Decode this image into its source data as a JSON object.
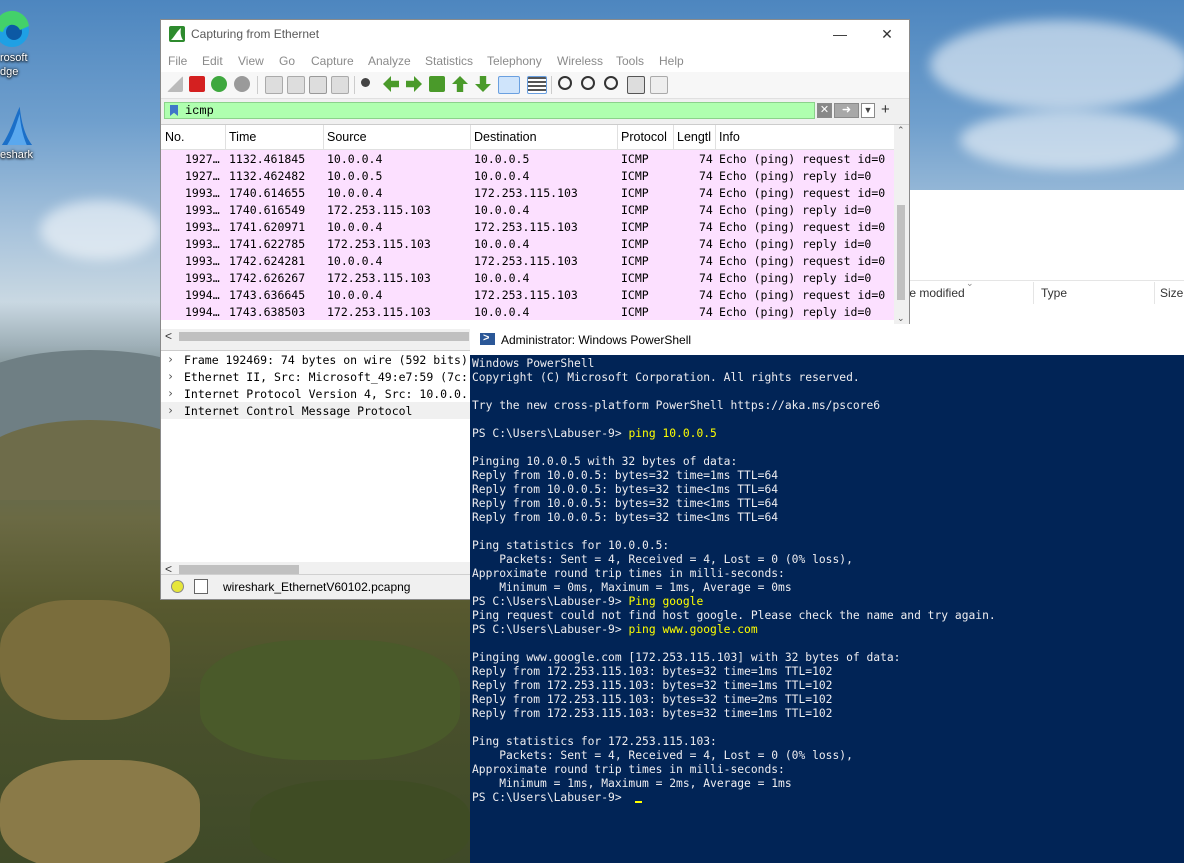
{
  "desktop": {
    "icons": [
      {
        "label_line1": "rosoft",
        "label_line2": "dge"
      },
      {
        "label_line1": "eshark",
        "label_line2": ""
      }
    ]
  },
  "explorer": {
    "columns": [
      "te modified",
      "Type",
      "Size"
    ]
  },
  "wireshark": {
    "title": "Capturing from Ethernet",
    "menu": [
      "File",
      "Edit",
      "View",
      "Go",
      "Capture",
      "Analyze",
      "Statistics",
      "Telephony",
      "Wireless",
      "Tools",
      "Help"
    ],
    "filter": {
      "value": "icmp"
    },
    "columns": [
      "No.",
      "Time",
      "Source",
      "Destination",
      "Protocol",
      "Lengtl",
      "Info"
    ],
    "packets": [
      {
        "no": "1927…",
        "time": "1132.461845",
        "src": "10.0.0.4",
        "dst": "10.0.0.5",
        "proto": "ICMP",
        "len": "74",
        "info": "Echo (ping) request  id=0"
      },
      {
        "no": "1927…",
        "time": "1132.462482",
        "src": "10.0.0.5",
        "dst": "10.0.0.4",
        "proto": "ICMP",
        "len": "74",
        "info": "Echo (ping) reply    id=0"
      },
      {
        "no": "1993…",
        "time": "1740.614655",
        "src": "10.0.0.4",
        "dst": "172.253.115.103",
        "proto": "ICMP",
        "len": "74",
        "info": "Echo (ping) request  id=0"
      },
      {
        "no": "1993…",
        "time": "1740.616549",
        "src": "172.253.115.103",
        "dst": "10.0.0.4",
        "proto": "ICMP",
        "len": "74",
        "info": "Echo (ping) reply    id=0"
      },
      {
        "no": "1993…",
        "time": "1741.620971",
        "src": "10.0.0.4",
        "dst": "172.253.115.103",
        "proto": "ICMP",
        "len": "74",
        "info": "Echo (ping) request  id=0"
      },
      {
        "no": "1993…",
        "time": "1741.622785",
        "src": "172.253.115.103",
        "dst": "10.0.0.4",
        "proto": "ICMP",
        "len": "74",
        "info": "Echo (ping) reply    id=0"
      },
      {
        "no": "1993…",
        "time": "1742.624281",
        "src": "10.0.0.4",
        "dst": "172.253.115.103",
        "proto": "ICMP",
        "len": "74",
        "info": "Echo (ping) request  id=0"
      },
      {
        "no": "1993…",
        "time": "1742.626267",
        "src": "172.253.115.103",
        "dst": "10.0.0.4",
        "proto": "ICMP",
        "len": "74",
        "info": "Echo (ping) reply    id=0"
      },
      {
        "no": "1994…",
        "time": "1743.636645",
        "src": "10.0.0.4",
        "dst": "172.253.115.103",
        "proto": "ICMP",
        "len": "74",
        "info": "Echo (ping) request  id=0"
      },
      {
        "no": "1994…",
        "time": "1743.638503",
        "src": "172.253.115.103",
        "dst": "10.0.0.4",
        "proto": "ICMP",
        "len": "74",
        "info": "Echo (ping) reply    id=0"
      }
    ],
    "details": [
      "Frame 192469: 74 bytes on wire (592 bits)",
      "Ethernet II, Src: Microsoft_49:e7:59 (7c:",
      "Internet Protocol Version 4, Src: 10.0.0.",
      "Internet Control Message Protocol"
    ],
    "status_file": "wireshark_EthernetV60102.pcapng"
  },
  "powershell": {
    "title": "Administrator: Windows PowerShell",
    "lines": [
      {
        "text": "Windows PowerShell"
      },
      {
        "text": "Copyright (C) Microsoft Corporation. All rights reserved."
      },
      {
        "text": ""
      },
      {
        "text": "Try the new cross-platform PowerShell https://aka.ms/pscore6"
      },
      {
        "text": ""
      },
      {
        "prompt": "PS C:\\Users\\Labuser-9> ",
        "cmd": "ping 10.0.0.5"
      },
      {
        "text": ""
      },
      {
        "text": "Pinging 10.0.0.5 with 32 bytes of data:"
      },
      {
        "text": "Reply from 10.0.0.5: bytes=32 time=1ms TTL=64"
      },
      {
        "text": "Reply from 10.0.0.5: bytes=32 time<1ms TTL=64"
      },
      {
        "text": "Reply from 10.0.0.5: bytes=32 time<1ms TTL=64"
      },
      {
        "text": "Reply from 10.0.0.5: bytes=32 time<1ms TTL=64"
      },
      {
        "text": ""
      },
      {
        "text": "Ping statistics for 10.0.0.5:"
      },
      {
        "text": "    Packets: Sent = 4, Received = 4, Lost = 0 (0% loss),"
      },
      {
        "text": "Approximate round trip times in milli-seconds:"
      },
      {
        "text": "    Minimum = 0ms, Maximum = 1ms, Average = 0ms"
      },
      {
        "prompt": "PS C:\\Users\\Labuser-9> ",
        "cmd": "Ping google"
      },
      {
        "text": "Ping request could not find host google. Please check the name and try again."
      },
      {
        "prompt": "PS C:\\Users\\Labuser-9> ",
        "cmd": "ping www.google.com"
      },
      {
        "text": ""
      },
      {
        "text": "Pinging www.google.com [172.253.115.103] with 32 bytes of data:"
      },
      {
        "text": "Reply from 172.253.115.103: bytes=32 time=1ms TTL=102"
      },
      {
        "text": "Reply from 172.253.115.103: bytes=32 time=1ms TTL=102"
      },
      {
        "text": "Reply from 172.253.115.103: bytes=32 time=2ms TTL=102"
      },
      {
        "text": "Reply from 172.253.115.103: bytes=32 time=1ms TTL=102"
      },
      {
        "text": ""
      },
      {
        "text": "Ping statistics for 172.253.115.103:"
      },
      {
        "text": "    Packets: Sent = 4, Received = 4, Lost = 0 (0% loss),"
      },
      {
        "text": "Approximate round trip times in milli-seconds:"
      },
      {
        "text": "    Minimum = 1ms, Maximum = 2ms, Average = 1ms"
      },
      {
        "prompt": "PS C:\\Users\\Labuser-9> ",
        "cmd": "",
        "cursor": true
      }
    ]
  }
}
